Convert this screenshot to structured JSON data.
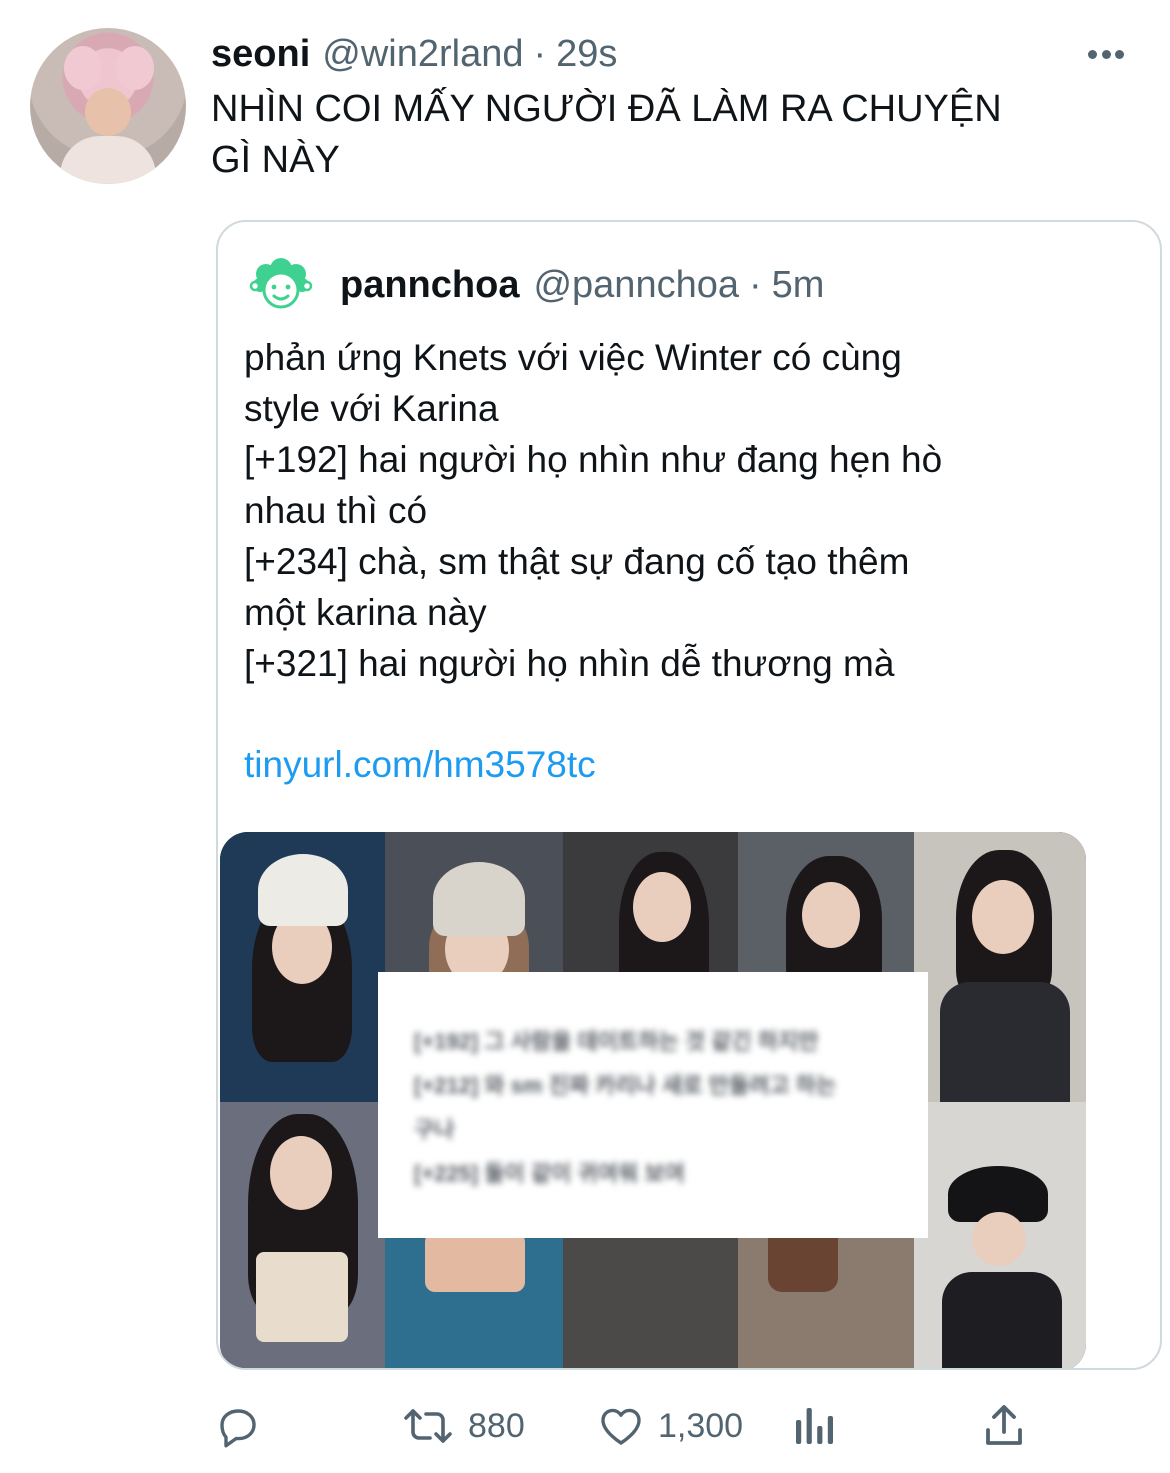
{
  "tweet": {
    "author_name": "seoni",
    "handle": "@win2rland",
    "separator": "·",
    "time": "29s",
    "text": "NHÌN COI MẤY NGƯỜI ĐÃ LÀM RA CHUYỆN\nGÌ NÀY"
  },
  "quote": {
    "author_name": "pannchoa",
    "handle": "@pannchoa",
    "separator": "·",
    "time": "5m",
    "lines": [
      "phản ứng Knets với việc Winter có cùng",
      "style với Karina",
      "[+192] hai người họ nhìn như đang hẹn hò",
      "nhau thì có",
      "[+234] chà, sm thật sự đang cố tạo thêm",
      "một karina này",
      "[+321] hai người họ nhìn dễ thương mà"
    ],
    "link": "tinyurl.com/hm3578tc",
    "image": {
      "overlay_lines": [
        "[+192] 그 사람을 데이트하는 것 같긴 하지만",
        "[+212] 와 sm 진짜 카리나 새로 만들려고 하는",
        "구나",
        "[+225] 둘이 같이 귀여워 보여"
      ]
    }
  },
  "actions": {
    "reply_icon": "reply-icon",
    "retweet_icon": "retweet-icon",
    "retweet_count": "880",
    "like_icon": "heart-icon",
    "like_count": "1,300",
    "analytics_icon": "analytics-icon",
    "share_icon": "share-icon"
  },
  "colors": {
    "text": "#0f1419",
    "secondary": "#536471",
    "link": "#1d9bf0",
    "border": "#cfd9de",
    "pannchoa_green": "#3fd18f"
  }
}
